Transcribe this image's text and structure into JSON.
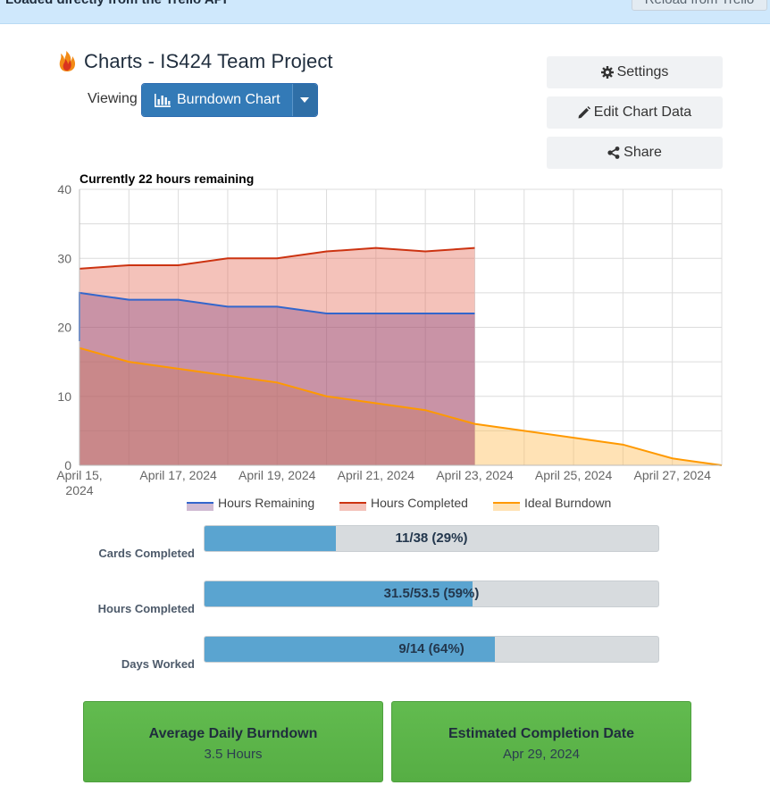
{
  "banner": {
    "message": "Loaded directly from the Trello API",
    "reload_label": "Reload from Trello"
  },
  "header": {
    "title": "Charts - IS424 Team Project",
    "viewing_label": "Viewing",
    "view_selected": "Burndown Chart"
  },
  "actions": {
    "settings": "Settings",
    "edit": "Edit Chart Data",
    "share": "Share"
  },
  "chart_caption": "Currently 22 hours remaining",
  "chart_data": {
    "type": "area",
    "title": "Currently 22 hours remaining",
    "x": [
      "2024-04-15",
      "2024-04-16",
      "2024-04-17",
      "2024-04-18",
      "2024-04-19",
      "2024-04-20",
      "2024-04-21",
      "2024-04-22",
      "2024-04-23",
      "2024-04-24",
      "2024-04-25",
      "2024-04-26",
      "2024-04-27",
      "2024-04-28"
    ],
    "x_tick_labels": [
      "April 15, 2024",
      "April 17, 2024",
      "April 19, 2024",
      "April 21, 2024",
      "April 23, 2024",
      "April 25, 2024",
      "April 27, 2024"
    ],
    "ylim": [
      0,
      40
    ],
    "y_ticks": [
      0,
      10,
      20,
      30,
      40
    ],
    "grid": true,
    "legend_position": "bottom",
    "series": [
      {
        "name": "Hours Remaining",
        "color": "#3366cc",
        "fill": "rgba(120,60,130,0.35)",
        "points": [
          [
            "2024-04-15",
            18
          ],
          [
            "2024-04-15",
            25
          ],
          [
            "2024-04-16",
            24
          ],
          [
            "2024-04-17",
            24
          ],
          [
            "2024-04-18",
            23
          ],
          [
            "2024-04-19",
            23
          ],
          [
            "2024-04-20",
            22
          ],
          [
            "2024-04-21",
            22
          ],
          [
            "2024-04-22",
            22
          ],
          [
            "2024-04-23",
            22
          ]
        ]
      },
      {
        "name": "Hours Completed",
        "color": "#cc3311",
        "fill": "rgba(228,110,90,0.42)",
        "points": [
          [
            "2024-04-15",
            28.5
          ],
          [
            "2024-04-16",
            29
          ],
          [
            "2024-04-17",
            29
          ],
          [
            "2024-04-18",
            30
          ],
          [
            "2024-04-19",
            30
          ],
          [
            "2024-04-20",
            31
          ],
          [
            "2024-04-21",
            31.5
          ],
          [
            "2024-04-22",
            31
          ],
          [
            "2024-04-23",
            31.5
          ]
        ]
      },
      {
        "name": "Ideal Burndown",
        "color": "#ff9900",
        "fill": "rgba(255,190,90,0.45)",
        "points": [
          [
            "2024-04-15",
            17
          ],
          [
            "2024-04-16",
            15
          ],
          [
            "2024-04-17",
            14
          ],
          [
            "2024-04-18",
            13
          ],
          [
            "2024-04-19",
            12
          ],
          [
            "2024-04-20",
            10
          ],
          [
            "2024-04-21",
            9
          ],
          [
            "2024-04-22",
            8
          ],
          [
            "2024-04-23",
            6
          ],
          [
            "2024-04-24",
            5
          ],
          [
            "2024-04-25",
            4
          ],
          [
            "2024-04-26",
            3
          ],
          [
            "2024-04-27",
            1
          ],
          [
            "2024-04-28",
            0
          ]
        ]
      }
    ]
  },
  "progress": [
    {
      "label": "Cards Completed",
      "text": "11/38 (29%)",
      "fraction": 0.29
    },
    {
      "label": "Hours Completed",
      "text": "31.5/53.5 (59%)",
      "fraction": 0.59
    },
    {
      "label": "Days Worked",
      "text": "9/14 (64%)",
      "fraction": 0.64
    }
  ],
  "stats": [
    {
      "heading": "Average Daily Burndown",
      "value": "3.5 Hours"
    },
    {
      "heading": "Estimated Completion Date",
      "value": "Apr 29, 2024"
    }
  ],
  "colors": {
    "primary": "#337ab7",
    "success": "#5cb85c",
    "progress": "#5aa4d0"
  }
}
